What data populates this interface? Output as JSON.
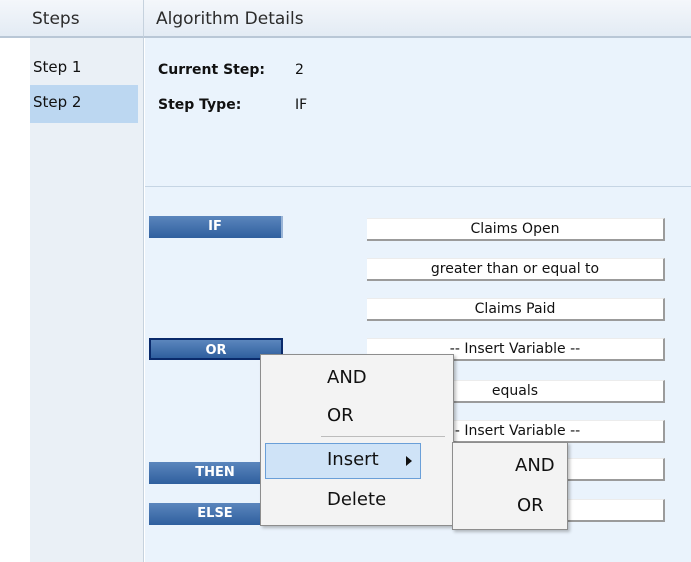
{
  "steps_panel": {
    "header": "Steps",
    "items": [
      {
        "label": "Step 1"
      },
      {
        "label": "Step 2"
      }
    ]
  },
  "details": {
    "header": "Algorithm Details",
    "current_step_label": "Current Step:",
    "current_step_value": "2",
    "step_type_label": "Step Type:",
    "step_type_value": "IF",
    "rows": {
      "if_keyword": "IF",
      "or_keyword": "OR",
      "then_keyword": "THEN",
      "else_keyword": "ELSE",
      "claims_open": "Claims Open",
      "operator_1": "greater than or equal to",
      "claims_paid": "Claims Paid",
      "insert_variable_1": "-- Insert Variable --",
      "operator_2": "equals",
      "insert_variable_2": "-- Insert Variable --"
    }
  },
  "context_menu": {
    "and": "AND",
    "or": "OR",
    "insert": "Insert",
    "delete": "Delete"
  },
  "submenu": {
    "and": "AND",
    "or": "OR"
  },
  "colors": {
    "keyword_bg": "#2f5f9e",
    "selected_step": "#bcd7f1",
    "details_bg": "#eaf3fc",
    "menu_highlight": "#cfe3f7"
  }
}
